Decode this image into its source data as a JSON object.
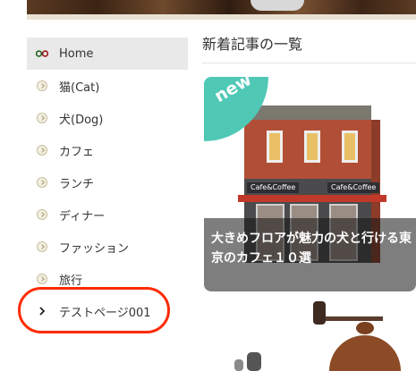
{
  "sidebar": {
    "items": [
      {
        "label": "Home",
        "icon": "glasses-icon"
      },
      {
        "label": "猫(Cat)",
        "icon": "circle-chevron-icon"
      },
      {
        "label": "犬(Dog)",
        "icon": "circle-chevron-icon"
      },
      {
        "label": "カフェ",
        "icon": "circle-chevron-icon"
      },
      {
        "label": "ランチ",
        "icon": "circle-chevron-icon"
      },
      {
        "label": "ディナー",
        "icon": "circle-chevron-icon"
      },
      {
        "label": "ファッション",
        "icon": "circle-chevron-icon"
      },
      {
        "label": "旅行",
        "icon": "circle-chevron-icon"
      },
      {
        "label": "テストページ001",
        "icon": "chevron-right-icon"
      }
    ]
  },
  "main": {
    "heading": "新着記事の一覧",
    "articles": [
      {
        "badge": "new",
        "title": "大きめフロアが魅力の犬と行ける東京のカフェ１０選",
        "sign_left": "Cafe&Coffee",
        "sign_right": "Cafe&Coffee"
      }
    ]
  },
  "colors": {
    "badge": "#4fc8b6",
    "highlight_ring": "#ff2a00",
    "active_nav_bg": "#e9e9e9"
  }
}
